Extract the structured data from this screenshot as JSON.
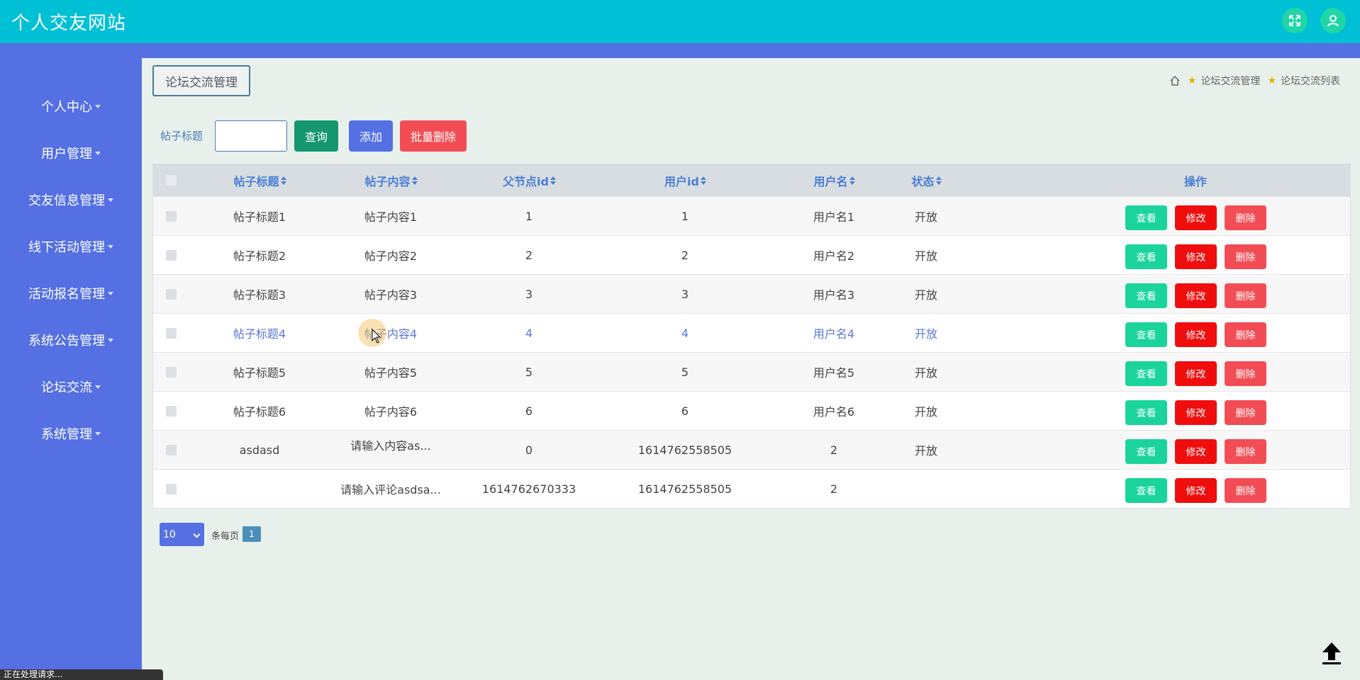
{
  "header": {
    "title": "个人交友网站",
    "fullscreen_icon": "expand-icon",
    "user_icon": "user-icon"
  },
  "sidebar": {
    "items": [
      {
        "label": "个人中心"
      },
      {
        "label": "用户管理"
      },
      {
        "label": "交友信息管理"
      },
      {
        "label": "线下活动管理"
      },
      {
        "label": "活动报名管理"
      },
      {
        "label": "系统公告管理"
      },
      {
        "label": "论坛交流"
      },
      {
        "label": "系统管理"
      }
    ]
  },
  "page": {
    "tab_title": "论坛交流管理",
    "breadcrumb": [
      "论坛交流管理",
      "论坛交流列表"
    ]
  },
  "search": {
    "label": "帖子标题",
    "value": "",
    "query_label": "查询",
    "add_label": "添加",
    "batch_delete_label": "批量删除"
  },
  "table": {
    "headers": [
      "帖子标题",
      "帖子内容",
      "父节点id",
      "用户id",
      "用户名",
      "状态",
      "操作"
    ],
    "action_labels": {
      "view": "查看",
      "edit": "修改",
      "delete": "删除"
    },
    "rows": [
      {
        "title": "帖子标题1",
        "content": "帖子内容1",
        "parentid": "1",
        "userid": "1",
        "username": "用户名1",
        "status": "开放"
      },
      {
        "title": "帖子标题2",
        "content": "帖子内容2",
        "parentid": "2",
        "userid": "2",
        "username": "用户名2",
        "status": "开放"
      },
      {
        "title": "帖子标题3",
        "content": "帖子内容3",
        "parentid": "3",
        "userid": "3",
        "username": "用户名3",
        "status": "开放"
      },
      {
        "title": "帖子标题4",
        "content": "帖子内容4",
        "parentid": "4",
        "userid": "4",
        "username": "用户名4",
        "status": "开放"
      },
      {
        "title": "帖子标题5",
        "content": "帖子内容5",
        "parentid": "5",
        "userid": "5",
        "username": "用户名5",
        "status": "开放"
      },
      {
        "title": "帖子标题6",
        "content": "帖子内容6",
        "parentid": "6",
        "userid": "6",
        "username": "用户名6",
        "status": "开放"
      },
      {
        "title": "asdasd",
        "content": "请输入内容as...",
        "parentid": "0",
        "userid": "1614762558505",
        "username": "2",
        "status": "开放"
      },
      {
        "title": "",
        "content": "请输入评论asdsa...",
        "parentid": "1614762670333",
        "userid": "1614762558505",
        "username": "2",
        "status": ""
      }
    ]
  },
  "pagination": {
    "page_size": "10",
    "page_size_label": "条每页",
    "current_page": "1"
  },
  "status_bar": "正在处理请求..."
}
